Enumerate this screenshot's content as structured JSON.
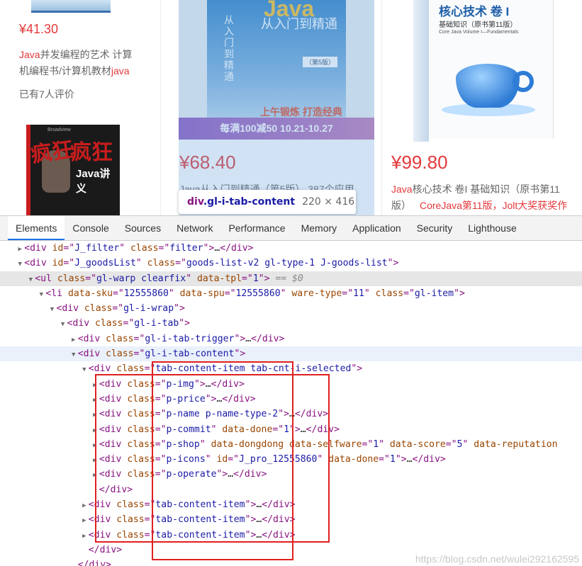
{
  "products": [
    {
      "price": "¥41.30",
      "name_parts": [
        {
          "text": "Java",
          "highlight": true
        },
        {
          "text": "并发编程的艺术 计算",
          "highlight": false
        }
      ],
      "name_line2": [
        {
          "text": "机编程书/计算机教材",
          "highlight": false
        },
        {
          "text": "java",
          "highlight": true
        }
      ],
      "comment": "已有7人评价"
    },
    {
      "price": "¥68.40",
      "cover_brand": "Java",
      "cover_sub": "从入门到精通",
      "cover_vertical": "从入门到精通",
      "cover_edition": "（第5版）",
      "cover_slogan": "上午锻炼 打造经典",
      "promo_banner": "每满100减50 10.21-10.27",
      "name_partial": "Java从入门到精通（第5版） 387个应用"
    },
    {
      "price": "¥99.80",
      "cover_title": "核心技术 卷 I",
      "cover_subtitle": "基础知识（原书第11版）",
      "cover_english": "Core Java Volume I—Fundamentals",
      "name_parts": [
        {
          "text": "Java",
          "highlight": true
        },
        {
          "text": "核心技术 卷I 基础知识（原书第11",
          "highlight": false
        }
      ],
      "name_line2": "版）",
      "name_ad": "CoreJava第11版，Jolt大奖获奖作"
    },
    {
      "cover_title_a": "疯狂",
      "cover_title_b": "疯狂",
      "cover_java": "Java讲义",
      "cover_logo": "Broadview"
    }
  ],
  "tooltip": {
    "tag": "div",
    "cls": ".gl-i-tab-content",
    "size": "220 × 416"
  },
  "devtools": {
    "tabs": [
      "Elements",
      "Console",
      "Sources",
      "Network",
      "Performance",
      "Memory",
      "Application",
      "Security",
      "Lighthouse"
    ],
    "active_tab": "Elements",
    "tree": [
      {
        "indent": 2,
        "arrow": "▶",
        "state": "",
        "parts": [
          [
            "tg",
            "<div "
          ],
          [
            "at",
            "id"
          ],
          [
            "tg",
            "=\""
          ],
          [
            "av",
            "J_filter"
          ],
          [
            "tg",
            "\" "
          ],
          [
            "at",
            "class"
          ],
          [
            "tg",
            "=\""
          ],
          [
            "av",
            "filter"
          ],
          [
            "tg",
            "\">"
          ],
          [
            "tx",
            "…"
          ],
          [
            "tg",
            "</div>"
          ]
        ]
      },
      {
        "indent": 2,
        "arrow": "▼",
        "state": "",
        "parts": [
          [
            "tg",
            "<div "
          ],
          [
            "at",
            "id"
          ],
          [
            "tg",
            "=\""
          ],
          [
            "av",
            "J_goodsList"
          ],
          [
            "tg",
            "\" "
          ],
          [
            "at",
            "class"
          ],
          [
            "tg",
            "=\""
          ],
          [
            "av",
            "goods-list-v2 gl-type-1 J-goods-list"
          ],
          [
            "tg",
            "\">"
          ]
        ]
      },
      {
        "indent": 3,
        "arrow": "▼",
        "state": "sel",
        "parts": [
          [
            "tg",
            "<ul "
          ],
          [
            "at",
            "class"
          ],
          [
            "tg",
            "=\""
          ],
          [
            "av",
            "gl-warp clearfix"
          ],
          [
            "tg",
            "\" "
          ],
          [
            "at",
            "data-tpl"
          ],
          [
            "tg",
            "=\""
          ],
          [
            "av",
            "1"
          ],
          [
            "tg",
            "\">"
          ],
          [
            "mark",
            " == $0"
          ]
        ]
      },
      {
        "indent": 4,
        "arrow": "▼",
        "state": "",
        "parts": [
          [
            "tg",
            "<li "
          ],
          [
            "at",
            "data-sku"
          ],
          [
            "tg",
            "=\""
          ],
          [
            "av",
            "12555860"
          ],
          [
            "tg",
            "\" "
          ],
          [
            "at",
            "data-spu"
          ],
          [
            "tg",
            "=\""
          ],
          [
            "av",
            "12555860"
          ],
          [
            "tg",
            "\" "
          ],
          [
            "at",
            "ware-type"
          ],
          [
            "tg",
            "=\""
          ],
          [
            "av",
            "11"
          ],
          [
            "tg",
            "\" "
          ],
          [
            "at",
            "class"
          ],
          [
            "tg",
            "=\""
          ],
          [
            "av",
            "gl-item"
          ],
          [
            "tg",
            "\">"
          ]
        ]
      },
      {
        "indent": 5,
        "arrow": "▼",
        "state": "",
        "parts": [
          [
            "tg",
            "<div "
          ],
          [
            "at",
            "class"
          ],
          [
            "tg",
            "=\""
          ],
          [
            "av",
            "gl-i-wrap"
          ],
          [
            "tg",
            "\">"
          ]
        ]
      },
      {
        "indent": 6,
        "arrow": "▼",
        "state": "",
        "parts": [
          [
            "tg",
            "<div "
          ],
          [
            "at",
            "class"
          ],
          [
            "tg",
            "=\""
          ],
          [
            "av",
            "gl-i-tab"
          ],
          [
            "tg",
            "\">"
          ]
        ]
      },
      {
        "indent": 7,
        "arrow": "▶",
        "state": "",
        "parts": [
          [
            "tg",
            "<div "
          ],
          [
            "at",
            "class"
          ],
          [
            "tg",
            "=\""
          ],
          [
            "av",
            "gl-i-tab-trigger"
          ],
          [
            "tg",
            "\">"
          ],
          [
            "tx",
            "…"
          ],
          [
            "tg",
            "</div>"
          ]
        ]
      },
      {
        "indent": 7,
        "arrow": "▼",
        "state": "hov",
        "parts": [
          [
            "tg",
            "<div "
          ],
          [
            "at",
            "class"
          ],
          [
            "tg",
            "=\""
          ],
          [
            "av",
            "gl-i-tab-content"
          ],
          [
            "tg",
            "\">"
          ]
        ]
      },
      {
        "indent": 8,
        "arrow": "▼",
        "state": "",
        "parts": [
          [
            "tg",
            "<div "
          ],
          [
            "at",
            "class"
          ],
          [
            "tg",
            "=\""
          ],
          [
            "av",
            "tab-content-item tab-cnt-i-selected"
          ],
          [
            "tg",
            "\">"
          ]
        ]
      },
      {
        "indent": 9,
        "arrow": "▶",
        "state": "",
        "parts": [
          [
            "tg",
            "<div "
          ],
          [
            "at",
            "class"
          ],
          [
            "tg",
            "=\""
          ],
          [
            "av",
            "p-img"
          ],
          [
            "tg",
            "\">"
          ],
          [
            "tx",
            "…"
          ],
          [
            "tg",
            "</div>"
          ]
        ]
      },
      {
        "indent": 9,
        "arrow": "▶",
        "state": "",
        "parts": [
          [
            "tg",
            "<div "
          ],
          [
            "at",
            "class"
          ],
          [
            "tg",
            "=\""
          ],
          [
            "av",
            "p-price"
          ],
          [
            "tg",
            "\">"
          ],
          [
            "tx",
            "…"
          ],
          [
            "tg",
            "</div>"
          ]
        ]
      },
      {
        "indent": 9,
        "arrow": "▶",
        "state": "",
        "parts": [
          [
            "tg",
            "<div "
          ],
          [
            "at",
            "class"
          ],
          [
            "tg",
            "=\""
          ],
          [
            "av",
            "p-name p-name-type-2"
          ],
          [
            "tg",
            "\">"
          ],
          [
            "tx",
            "…"
          ],
          [
            "tg",
            "</div>"
          ]
        ]
      },
      {
        "indent": 9,
        "arrow": "▶",
        "state": "",
        "parts": [
          [
            "tg",
            "<div "
          ],
          [
            "at",
            "class"
          ],
          [
            "tg",
            "=\""
          ],
          [
            "av",
            "p-commit"
          ],
          [
            "tg",
            "\" "
          ],
          [
            "at",
            "data-done"
          ],
          [
            "tg",
            "=\""
          ],
          [
            "av",
            "1"
          ],
          [
            "tg",
            "\">"
          ],
          [
            "tx",
            "…"
          ],
          [
            "tg",
            "</div>"
          ]
        ]
      },
      {
        "indent": 9,
        "arrow": "▶",
        "state": "",
        "parts": [
          [
            "tg",
            "<div "
          ],
          [
            "at",
            "class"
          ],
          [
            "tg",
            "=\""
          ],
          [
            "av",
            "p-shop"
          ],
          [
            "tg",
            "\" "
          ],
          [
            "at",
            "data-dongdong"
          ],
          [
            "tg",
            " "
          ],
          [
            "at",
            "data-selfware"
          ],
          [
            "tg",
            "=\""
          ],
          [
            "av",
            "1"
          ],
          [
            "tg",
            "\" "
          ],
          [
            "at",
            "data-score"
          ],
          [
            "tg",
            "=\""
          ],
          [
            "av",
            "5"
          ],
          [
            "tg",
            "\" "
          ],
          [
            "at",
            "data-reputation"
          ]
        ]
      },
      {
        "indent": 9,
        "arrow": "▶",
        "state": "",
        "parts": [
          [
            "tg",
            "<div "
          ],
          [
            "at",
            "class"
          ],
          [
            "tg",
            "=\""
          ],
          [
            "av",
            "p-icons"
          ],
          [
            "tg",
            "\" "
          ],
          [
            "at",
            "id"
          ],
          [
            "tg",
            "=\""
          ],
          [
            "av",
            "J_pro_12555860"
          ],
          [
            "tg",
            "\" "
          ],
          [
            "at",
            "data-done"
          ],
          [
            "tg",
            "=\""
          ],
          [
            "av",
            "1"
          ],
          [
            "tg",
            "\">"
          ],
          [
            "tx",
            "…"
          ],
          [
            "tg",
            "</div>"
          ]
        ]
      },
      {
        "indent": 9,
        "arrow": "▶",
        "state": "",
        "parts": [
          [
            "tg",
            "<div "
          ],
          [
            "at",
            "class"
          ],
          [
            "tg",
            "=\""
          ],
          [
            "av",
            "p-operate"
          ],
          [
            "tg",
            "\">"
          ],
          [
            "tx",
            "…"
          ],
          [
            "tg",
            "</div>"
          ]
        ]
      },
      {
        "indent": 9,
        "arrow": "",
        "state": "",
        "parts": [
          [
            "tg",
            "</div>"
          ]
        ]
      },
      {
        "indent": 8,
        "arrow": "▶",
        "state": "",
        "parts": [
          [
            "tg",
            "<div "
          ],
          [
            "at",
            "class"
          ],
          [
            "tg",
            "=\""
          ],
          [
            "av",
            "tab-content-item"
          ],
          [
            "tg",
            "\">"
          ],
          [
            "tx",
            "…"
          ],
          [
            "tg",
            "</div>"
          ]
        ]
      },
      {
        "indent": 8,
        "arrow": "▶",
        "state": "",
        "parts": [
          [
            "tg",
            "<div "
          ],
          [
            "at",
            "class"
          ],
          [
            "tg",
            "=\""
          ],
          [
            "av",
            "tab-content-item"
          ],
          [
            "tg",
            "\">"
          ],
          [
            "tx",
            "…"
          ],
          [
            "tg",
            "</div>"
          ]
        ]
      },
      {
        "indent": 8,
        "arrow": "▶",
        "state": "",
        "parts": [
          [
            "tg",
            "<div "
          ],
          [
            "at",
            "class"
          ],
          [
            "tg",
            "=\""
          ],
          [
            "av",
            "tab-content-item"
          ],
          [
            "tg",
            "\">"
          ],
          [
            "tx",
            "…"
          ],
          [
            "tg",
            "</div>"
          ]
        ]
      },
      {
        "indent": 8,
        "arrow": "",
        "state": "",
        "parts": [
          [
            "tg",
            "</div>"
          ]
        ]
      },
      {
        "indent": 7,
        "arrow": "",
        "state": "",
        "parts": [
          [
            "tg",
            "</div>"
          ]
        ]
      }
    ]
  },
  "watermark": "https://blog.csdn.net/wulei292162595",
  "colors": {
    "price_red": "#e4393c",
    "tag": "#881280",
    "attr": "#994500",
    "value": "#1a1aa6",
    "highlight_box": "#e02020",
    "active_tab": "#1a73e8"
  }
}
